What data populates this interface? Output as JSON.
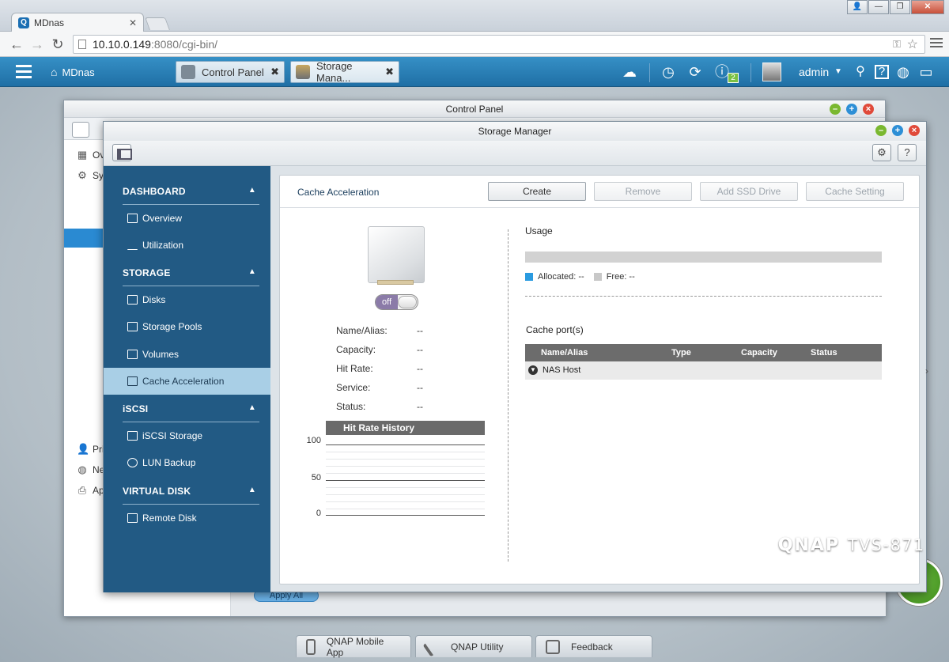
{
  "browser": {
    "tab_title": "MDnas",
    "url_host": "10.10.0.149",
    "url_rest": ":8080/cgi-bin/"
  },
  "qnap_bar": {
    "home_label": "MDnas",
    "tabs": [
      {
        "label": "Control Panel"
      },
      {
        "label": "Storage Mana..."
      }
    ],
    "notification_count": "2",
    "username": "admin"
  },
  "control_panel": {
    "title": "Control Panel",
    "sidebar": [
      "Ov",
      "Sy",
      "Pri",
      "Ne",
      "Ap"
    ],
    "apply_all": "Apply All"
  },
  "storage_manager": {
    "title": "Storage Manager",
    "nav": {
      "sections": [
        {
          "label": "DASHBOARD",
          "items": [
            "Overview",
            "Utilization"
          ]
        },
        {
          "label": "STORAGE",
          "items": [
            "Disks",
            "Storage Pools",
            "Volumes",
            "Cache Acceleration"
          ]
        },
        {
          "label": "iSCSI",
          "items": [
            "iSCSI Storage",
            "LUN Backup"
          ]
        },
        {
          "label": "VIRTUAL DISK",
          "items": [
            "Remote Disk"
          ]
        }
      ],
      "active": "Cache Acceleration"
    },
    "page_title": "Cache Acceleration",
    "actions": {
      "create": "Create",
      "remove": "Remove",
      "add_ssd": "Add SSD Drive",
      "cache_setting": "Cache Setting"
    },
    "toggle_label": "off",
    "info": [
      {
        "label": "Name/Alias:",
        "value": "--"
      },
      {
        "label": "Capacity:",
        "value": "--"
      },
      {
        "label": "Hit Rate:",
        "value": "--"
      },
      {
        "label": "Service:",
        "value": "--"
      },
      {
        "label": "Status:",
        "value": "--"
      }
    ],
    "hit_rate_history": {
      "title": "Hit Rate History",
      "ticks": [
        "100",
        "50",
        "0"
      ]
    },
    "usage": {
      "title": "Usage",
      "allocated_label": "Allocated: --",
      "free_label": "Free: --",
      "allocated_color": "#2a9be0",
      "free_color": "#c8c8c8"
    },
    "cache_ports": {
      "title": "Cache port(s)",
      "columns": [
        "Name/Alias",
        "Type",
        "Capacity",
        "Status"
      ],
      "rows": [
        {
          "name": "NAS Host"
        }
      ]
    }
  },
  "dock": {
    "items": [
      "QNAP Mobile App",
      "QNAP Utility",
      "Feedback"
    ]
  },
  "branding": {
    "logo": "QNAP",
    "model": "TVS-871"
  }
}
